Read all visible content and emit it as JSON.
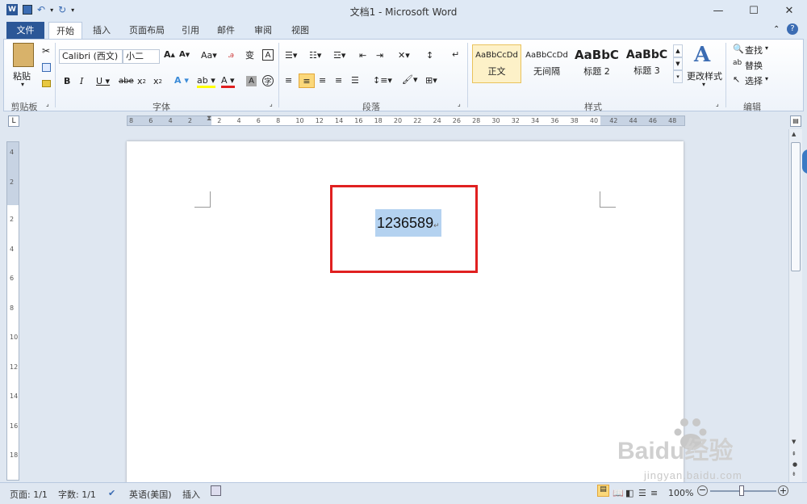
{
  "window": {
    "title": "文档1 - Microsoft Word"
  },
  "tabs": [
    "文件",
    "开始",
    "插入",
    "页面布局",
    "引用",
    "邮件",
    "审阅",
    "视图"
  ],
  "clipboard": {
    "paste": "粘贴",
    "label": "剪贴板"
  },
  "font": {
    "name": "Calibri (西文)",
    "size": "小二",
    "label": "字体"
  },
  "paragraph": {
    "label": "段落"
  },
  "styles": {
    "items": [
      {
        "preview": "AaBbCcDd",
        "name": "正文"
      },
      {
        "preview": "AaBbCcDd",
        "name": "无间隔"
      },
      {
        "preview": "AaBbC",
        "name": "标题 2"
      },
      {
        "preview": "AaBbC",
        "name": "标题 3"
      }
    ],
    "change": "更改样式",
    "label": "样式"
  },
  "editing": {
    "find": "查找",
    "replace": "替换",
    "select": "选择",
    "label": "编辑"
  },
  "document": {
    "text": "1236589"
  },
  "ruler": {
    "h": [
      "8",
      "6",
      "4",
      "2",
      "2",
      "4",
      "6",
      "8",
      "10",
      "12",
      "14",
      "16",
      "18",
      "20",
      "22",
      "24",
      "26",
      "28",
      "30",
      "32",
      "34",
      "36",
      "38",
      "40",
      "42",
      "44",
      "46",
      "48"
    ],
    "v": [
      "4",
      "2",
      "2",
      "4",
      "6",
      "8",
      "10",
      "12",
      "14",
      "16",
      "18"
    ]
  },
  "status": {
    "page": "页面: 1/1",
    "words": "字数: 1/1",
    "lang": "英语(美国)",
    "mode": "插入",
    "zoom": "100%"
  },
  "watermark": {
    "logo": "Baidu经验",
    "url": "jingyan.baidu.com"
  },
  "colors": {
    "accent": "#2b5797",
    "highlight": "#b4d2f0",
    "red_box": "#e02020"
  }
}
